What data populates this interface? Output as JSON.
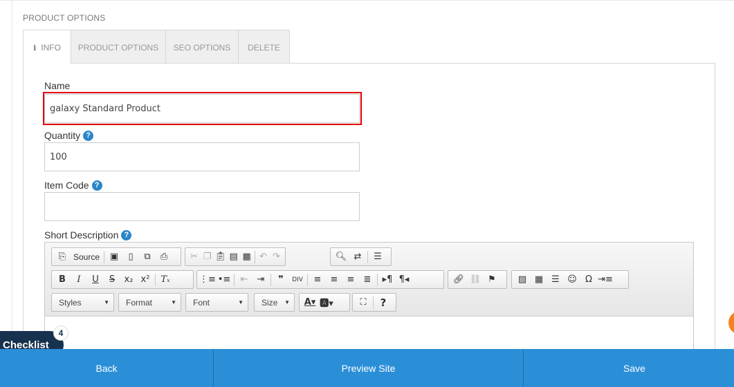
{
  "section_title": "PRODUCT OPTIONS",
  "tabs": [
    {
      "label": "INFO",
      "icon": "info-icon"
    },
    {
      "label": "PRODUCT OPTIONS"
    },
    {
      "label": "SEO OPTIONS"
    },
    {
      "label": "DELETE"
    }
  ],
  "form": {
    "name_label": "Name",
    "name_value": "galaxy Standard Product",
    "quantity_label": "Quantity",
    "quantity_value": "100",
    "item_code_label": "Item Code",
    "item_code_value": "",
    "short_description_label": "Short Description",
    "help_glyph": "?"
  },
  "editor": {
    "source_label": "Source",
    "combos": [
      "Styles",
      "Format",
      "Font",
      "Size"
    ]
  },
  "checklist": {
    "label": "Checklist",
    "count": "4"
  },
  "bottom_bar": {
    "back": "Back",
    "preview": "Preview Site",
    "save": "Save"
  },
  "colors": {
    "accent": "#2b8fd8",
    "highlight": "#e00000",
    "checklist_bg": "#17324e",
    "help": "#2a86c8",
    "orange": "#f58220"
  }
}
